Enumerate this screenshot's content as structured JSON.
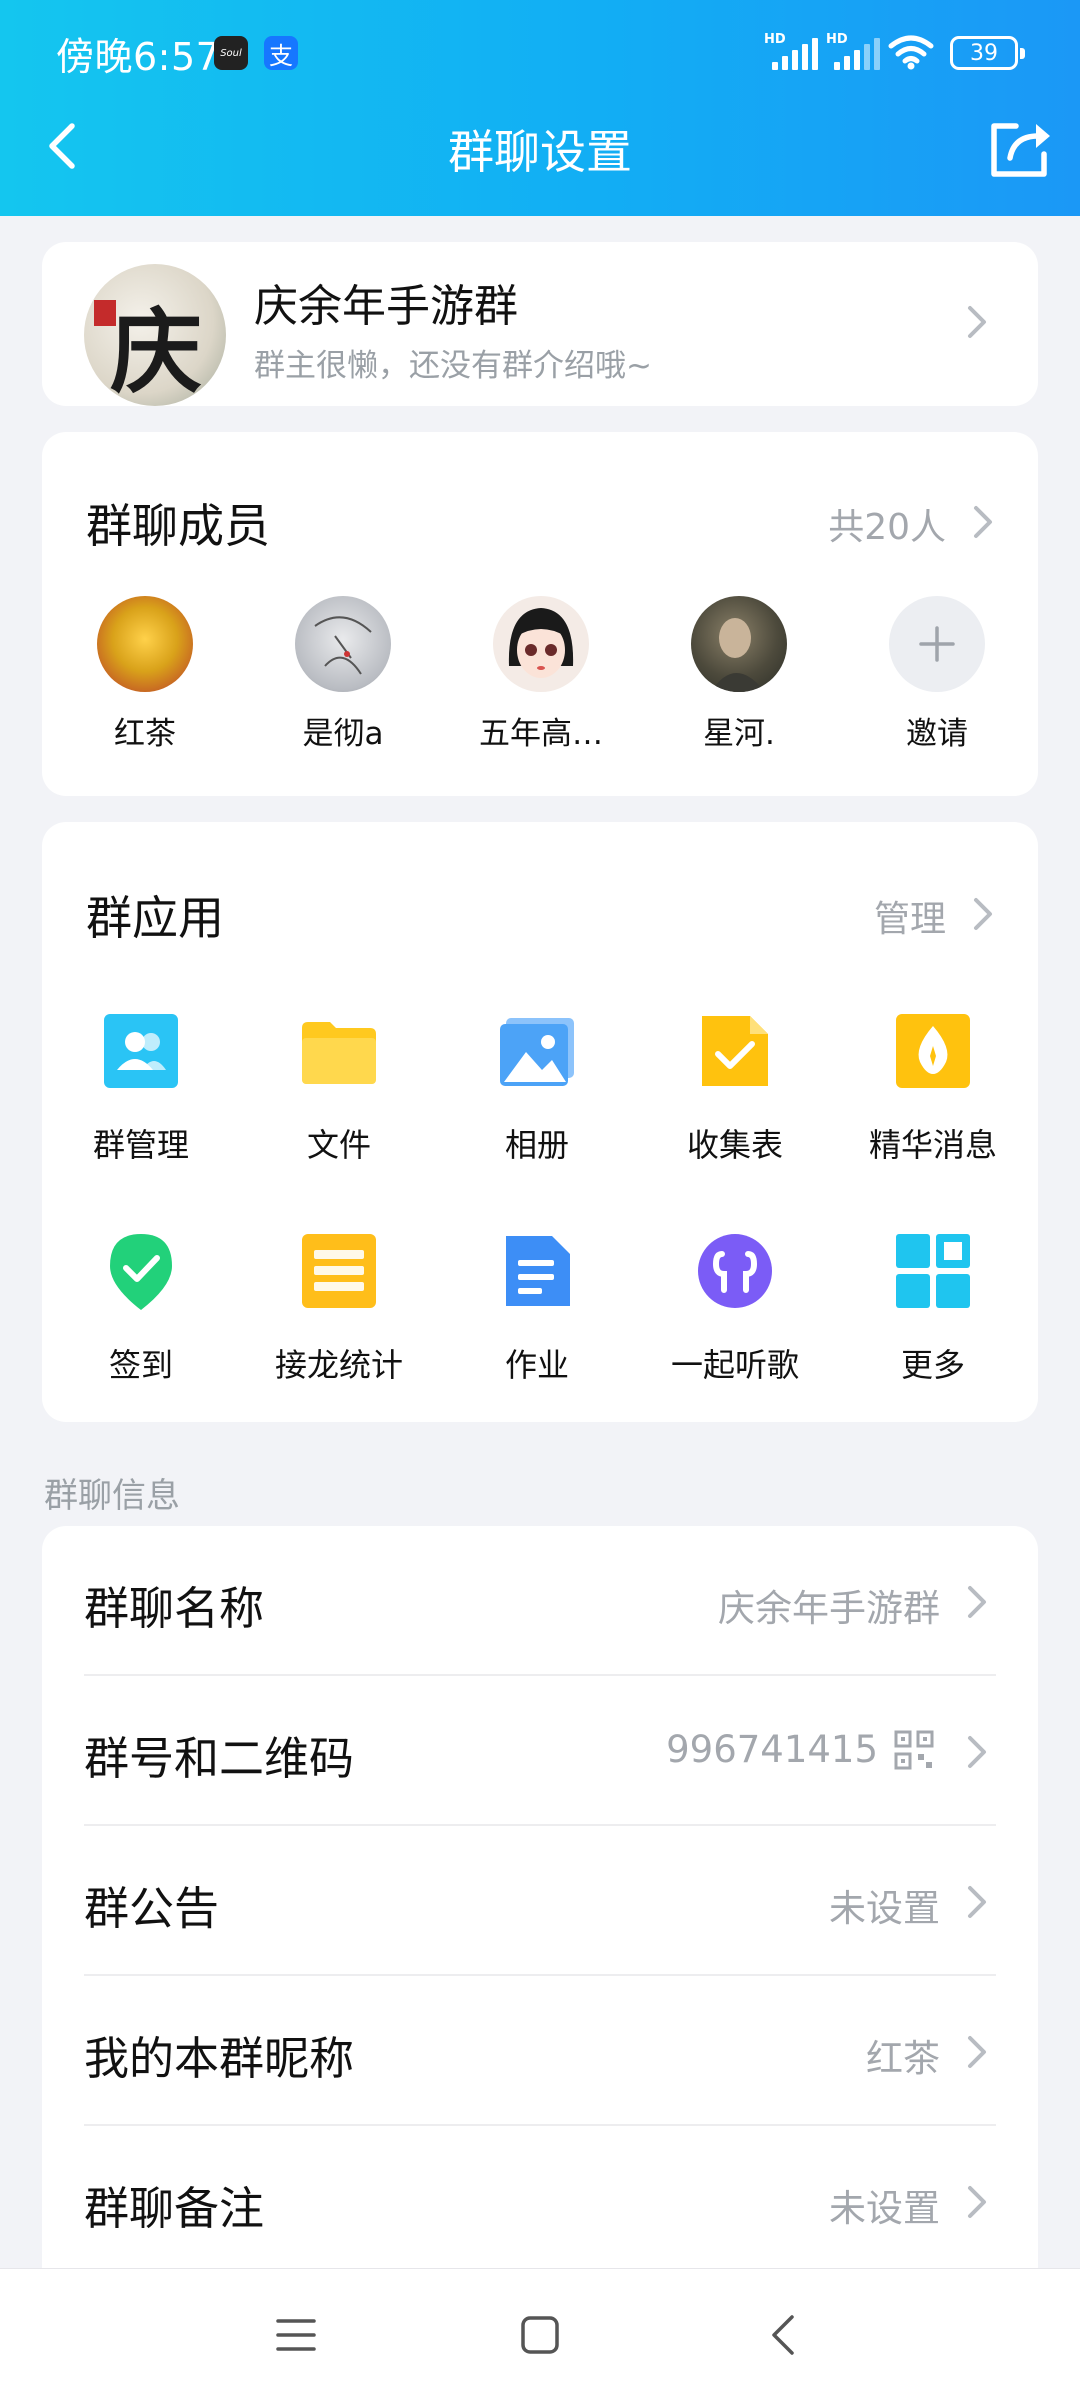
{
  "status": {
    "time": "傍晚6:57",
    "soul_label": "Soul",
    "alipay_label": "支",
    "signal_label": "HD",
    "battery": "39"
  },
  "header": {
    "title": "群聊设置"
  },
  "group": {
    "name": "庆余年手游群",
    "intro": "群主很懒，还没有群介绍哦~",
    "avatar_text": "庆"
  },
  "members": {
    "title": "群聊成员",
    "count": "共20人",
    "list": [
      {
        "name": "红茶"
      },
      {
        "name": "是彻a"
      },
      {
        "name": "五年高…"
      },
      {
        "name": "星河."
      },
      {
        "name": "邀请"
      }
    ]
  },
  "apps": {
    "title": "群应用",
    "manage": "管理",
    "items": [
      {
        "label": "群管理",
        "icon": "group-manage-icon",
        "color": "#2ac4f5"
      },
      {
        "label": "文件",
        "icon": "folder-icon",
        "color": "#ffc91f"
      },
      {
        "label": "相册",
        "icon": "photo-album-icon",
        "color": "#4ca3f7"
      },
      {
        "label": "收集表",
        "icon": "form-icon",
        "color": "#ffc20e"
      },
      {
        "label": "精华消息",
        "icon": "essence-icon",
        "color": "#ffc20e"
      },
      {
        "label": "签到",
        "icon": "check-in-icon",
        "color": "#22d17a"
      },
      {
        "label": "接龙统计",
        "icon": "relay-icon",
        "color": "#ffbe1a"
      },
      {
        "label": "作业",
        "icon": "homework-icon",
        "color": "#3d8ef6"
      },
      {
        "label": "一起听歌",
        "icon": "music-icon",
        "color": "#7b5cf6"
      },
      {
        "label": "更多",
        "icon": "more-grid-icon",
        "color": "#1fc5ef"
      }
    ]
  },
  "info": {
    "section_label": "群聊信息",
    "rows": [
      {
        "label": "群聊名称",
        "value": "庆余年手游群"
      },
      {
        "label": "群号和二维码",
        "value": "996741415"
      },
      {
        "label": "群公告",
        "value": "未设置"
      },
      {
        "label": "我的本群昵称",
        "value": "红茶"
      },
      {
        "label": "群聊备注",
        "value": "未设置"
      }
    ]
  }
}
